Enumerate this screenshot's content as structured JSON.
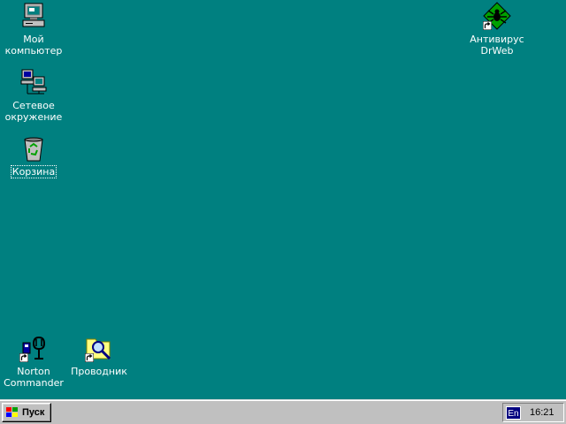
{
  "colors": {
    "desktop_background": "#008080",
    "taskbar": "#c0c0c0",
    "language_indicator": "#000080"
  },
  "desktop": {
    "icons": [
      {
        "name": "my-computer",
        "icon": "computer-icon",
        "label": "Мой\nкомпьютер"
      },
      {
        "name": "network-neighborhood",
        "icon": "network-computers-icon",
        "label": "Сетевое\nокружение"
      },
      {
        "name": "recycle-bin",
        "icon": "recycle-bin-icon",
        "label": "Корзина"
      },
      {
        "name": "antivirus-drweb",
        "icon": "spider-icon",
        "label": "Антивирус\nDrWeb",
        "shortcut": true
      },
      {
        "name": "norton-commander",
        "icon": "norton-commander-icon",
        "label": "Norton\nCommander",
        "shortcut": true
      },
      {
        "name": "explorer",
        "icon": "folder-magnifier-icon",
        "label": "Проводник",
        "shortcut": true
      }
    ]
  },
  "taskbar": {
    "start_label": "Пуск",
    "language": "En",
    "clock": "16:21"
  }
}
